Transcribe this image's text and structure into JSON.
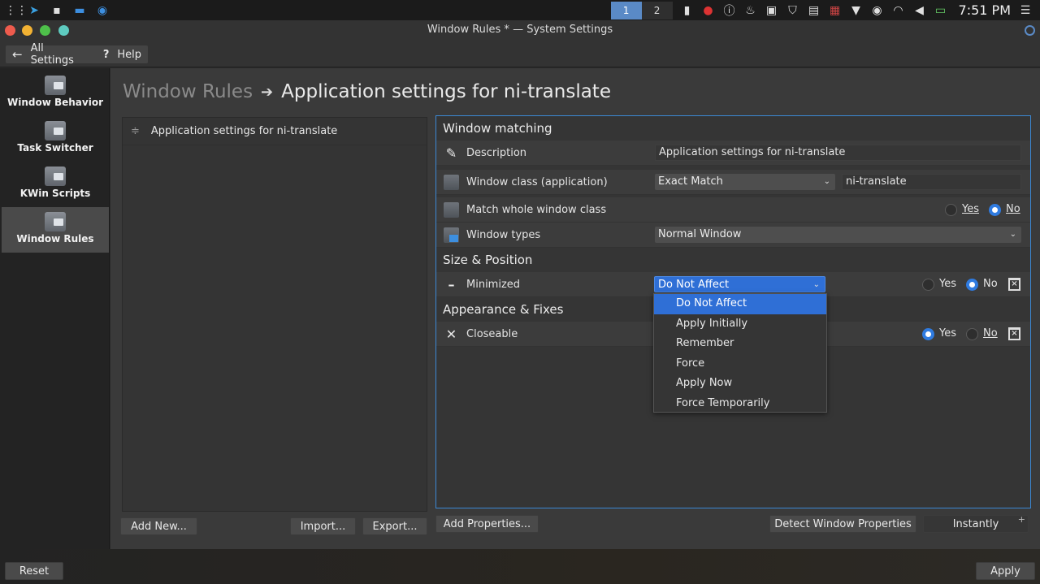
{
  "panel": {
    "pager": [
      "1",
      "2"
    ],
    "clock": "7:51 PM"
  },
  "window": {
    "title": "Window Rules * — System Settings"
  },
  "toolbar": {
    "all_settings": "All Settings",
    "help": "Help"
  },
  "sidebar": {
    "items": [
      {
        "label": "Window Behavior"
      },
      {
        "label": "Task Switcher"
      },
      {
        "label": "KWin Scripts"
      },
      {
        "label": "Window Rules"
      }
    ]
  },
  "breadcrumb": {
    "parent": "Window Rules",
    "current": "Application settings for ni-translate"
  },
  "rules": {
    "items": [
      "Application settings for ni-translate"
    ],
    "add_new": "Add New...",
    "import": "Import...",
    "export": "Export..."
  },
  "properties": {
    "sections": {
      "matching": "Window matching",
      "size": "Size & Position",
      "appearance": "Appearance & Fixes"
    },
    "description": {
      "label": "Description",
      "value": "Application settings for ni-translate"
    },
    "window_class": {
      "label": "Window class (application)",
      "match": "Exact Match",
      "value": "ni-translate"
    },
    "whole_class": {
      "label": "Match whole window class",
      "yes": "Yes",
      "no": "No"
    },
    "window_types": {
      "label": "Window types",
      "value": "Normal Window"
    },
    "minimized": {
      "label": "Minimized",
      "policy": "Do Not Affect",
      "yes": "Yes",
      "no": "No"
    },
    "closeable": {
      "label": "Closeable",
      "yes": "Yes",
      "no": "No"
    },
    "add_properties": "Add Properties...",
    "detect": "Detect Window Properties",
    "detect_delay": "Instantly"
  },
  "dropdown": {
    "options": [
      "Do Not Affect",
      "Apply Initially",
      "Remember",
      "Force",
      "Apply Now",
      "Force Temporarily"
    ]
  },
  "footer": {
    "reset": "Reset",
    "apply": "Apply"
  }
}
